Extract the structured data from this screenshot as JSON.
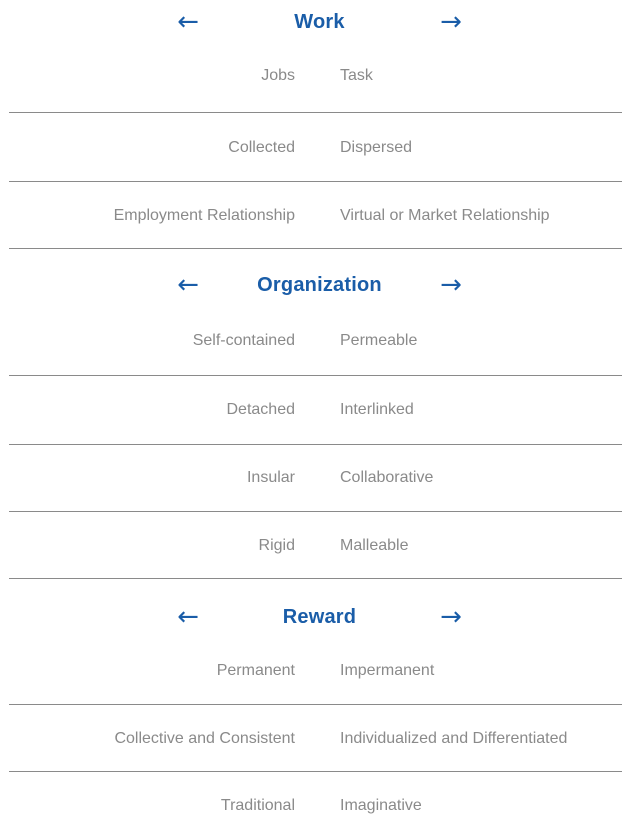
{
  "arrows": {
    "left": "←",
    "right": "→"
  },
  "colors": {
    "accent": "#1a5da8",
    "text": "#8a8a8a",
    "divider": "#8a8a8a"
  },
  "sections": [
    {
      "title": "Work",
      "rows": [
        {
          "left": "Jobs",
          "right": "Task"
        },
        {
          "left": "Collected",
          "right": "Dispersed"
        },
        {
          "left": "Employment Relationship",
          "right": "Virtual or Market Relationship"
        }
      ]
    },
    {
      "title": "Organization",
      "rows": [
        {
          "left": "Self-contained",
          "right": "Permeable"
        },
        {
          "left": "Detached",
          "right": "Interlinked"
        },
        {
          "left": "Insular",
          "right": "Collaborative"
        },
        {
          "left": "Rigid",
          "right": "Malleable"
        }
      ]
    },
    {
      "title": "Reward",
      "rows": [
        {
          "left": "Permanent",
          "right": "Impermanent"
        },
        {
          "left": "Collective and Consistent",
          "right": "Individualized and Differentiated"
        },
        {
          "left": "Traditional",
          "right": "Imaginative"
        }
      ]
    }
  ]
}
